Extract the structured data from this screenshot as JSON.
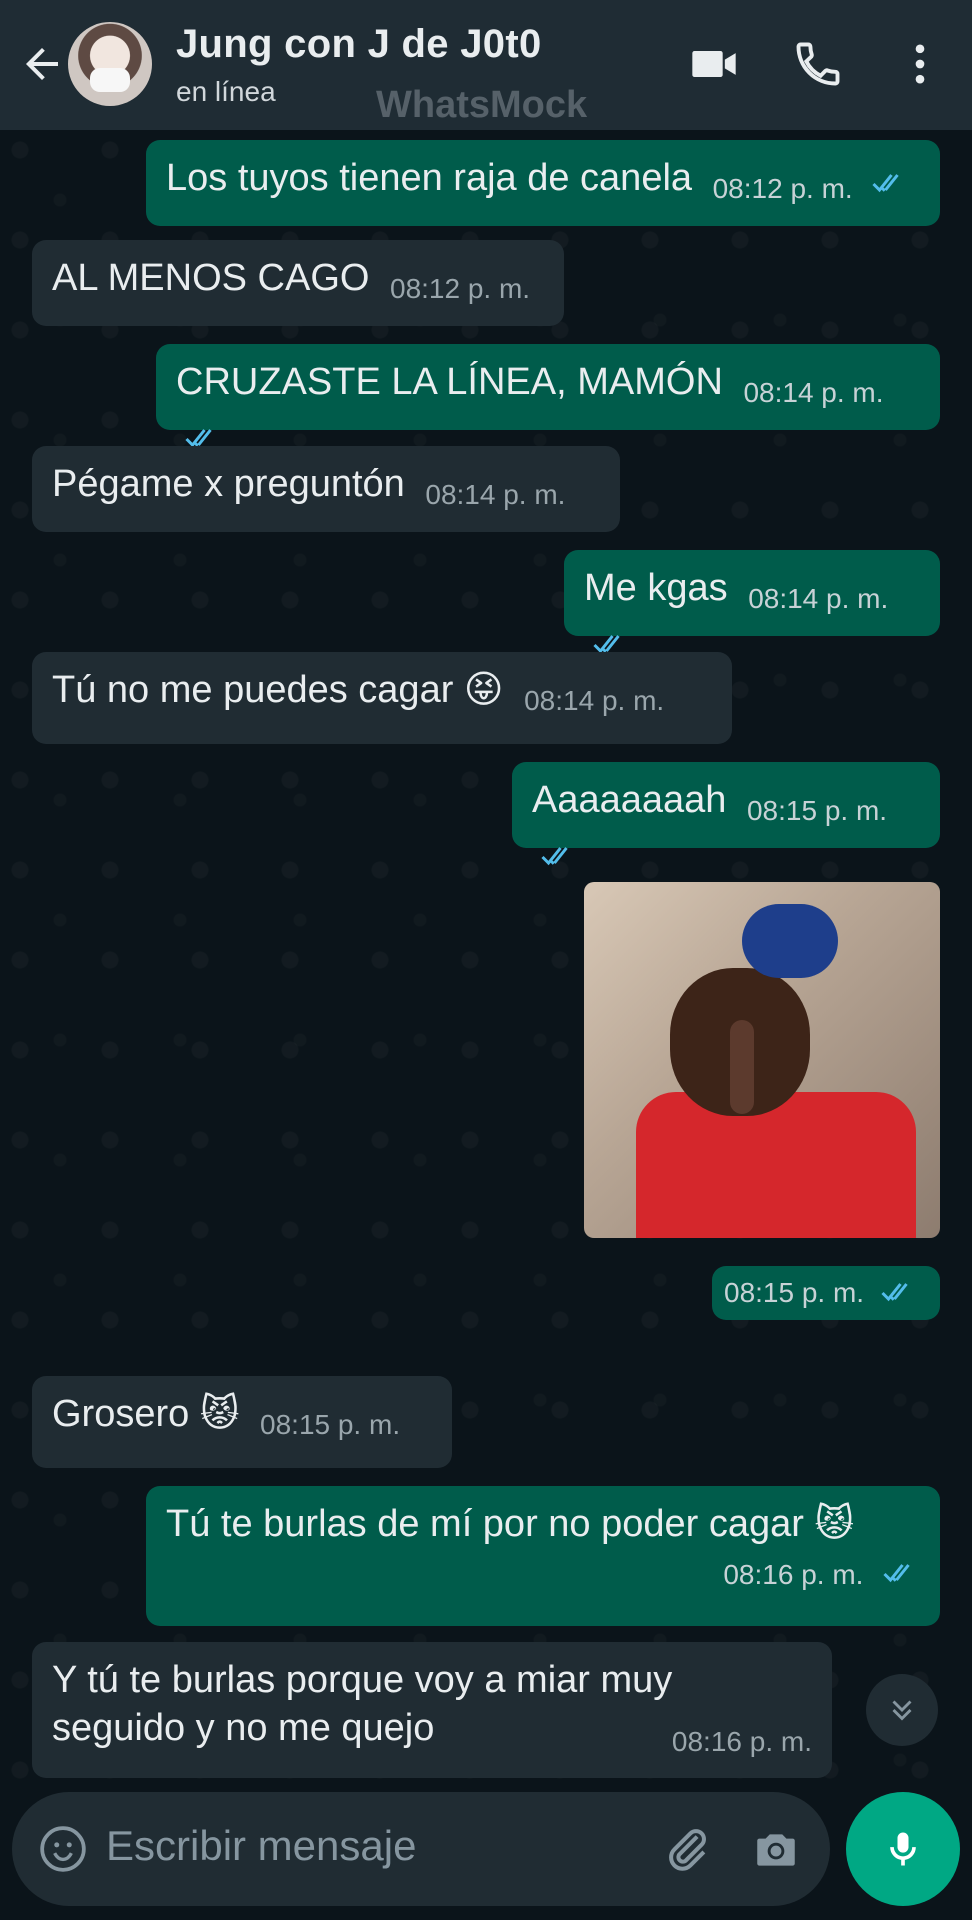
{
  "header": {
    "contact_name": "Jung con J de J0t0",
    "status": "en línea",
    "watermark": "WhatsMock",
    "icons": [
      "back-arrow-icon",
      "video-call-icon",
      "phone-call-icon",
      "more-options-icon"
    ]
  },
  "messages": [
    {
      "direction": "outgoing",
      "text": "Los tuyos tienen raja de canela",
      "time": "08:12 p. m.",
      "status": "read"
    },
    {
      "direction": "incoming",
      "text": "AL MENOS CAGO",
      "time": "08:12 p. m."
    },
    {
      "direction": "outgoing",
      "text": "CRUZASTE LA LÍNEA, MAMÓN",
      "time": "08:14 p. m.",
      "status": "read"
    },
    {
      "direction": "incoming",
      "text": "Pégame x preguntón",
      "time": "08:14 p. m."
    },
    {
      "direction": "outgoing",
      "text": "Me kgas",
      "time": "08:14 p. m.",
      "status": "read"
    },
    {
      "direction": "incoming",
      "text": "Tú no me puedes cagar 😝",
      "time": "08:14 p. m."
    },
    {
      "direction": "outgoing",
      "text": "Aaaaaaaah",
      "time": "08:15 p. m.",
      "status": "read"
    },
    {
      "direction": "outgoing",
      "type": "image",
      "time": "08:15 p. m.",
      "status": "read"
    },
    {
      "direction": "incoming",
      "text": "Grosero 😾",
      "time": "08:15 p. m."
    },
    {
      "direction": "outgoing",
      "text": "Tú te burlas de mí por no poder cagar 😾",
      "time": "08:16 p. m.",
      "status": "read"
    },
    {
      "direction": "incoming",
      "text": "Y tú te burlas porque voy a miar muy seguido y no me quejo",
      "time": "08:16 p. m."
    }
  ],
  "composer": {
    "placeholder": "Escribir mensaje",
    "icons": [
      "emoji-icon",
      "attach-icon",
      "camera-icon",
      "mic-icon"
    ]
  },
  "colors": {
    "header_bg": "#1f2c34",
    "chat_bg": "#0b141a",
    "outgoing_bubble": "#005c4b",
    "incoming_bubble": "#202c33",
    "accent": "#00a884",
    "read_ticks": "#53bdeb"
  }
}
